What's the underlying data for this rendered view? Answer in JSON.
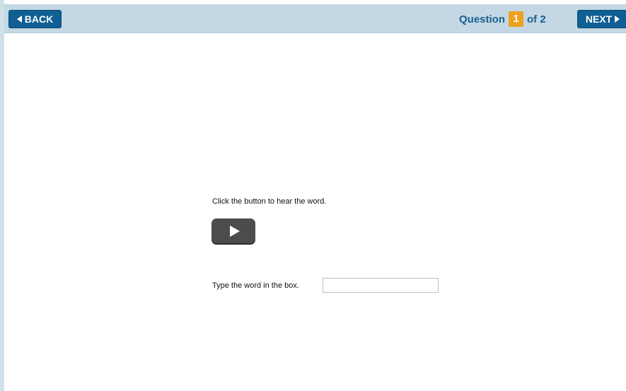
{
  "header": {
    "back_label": "BACK",
    "next_label": "NEXT",
    "question_label": "Question",
    "current_question": "1",
    "of_total": "of 2"
  },
  "question": {
    "prompt": "Click the button to hear the word.",
    "type_instruction": "Type the word in the box.",
    "answer_value": "",
    "answer_placeholder": ""
  },
  "colors": {
    "header_bg": "#c3d8e4",
    "button_bg": "#0f5f93",
    "question_number_bg": "#f0a020",
    "question_text": "#1a5f8e",
    "play_button_bg": "#4c4c4c"
  },
  "icons": {
    "back": "triangle-left-icon",
    "next": "triangle-right-icon",
    "play": "play-icon"
  }
}
